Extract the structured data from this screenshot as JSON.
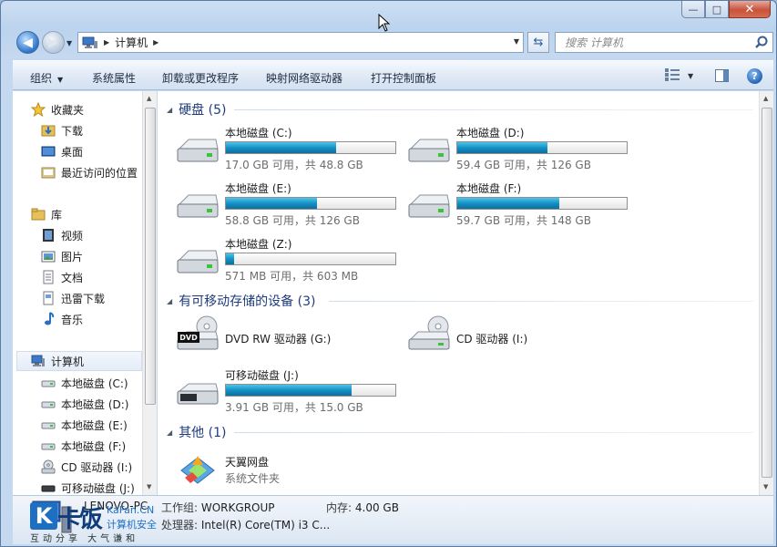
{
  "window": {
    "caption_buttons": {
      "minimize": "—",
      "maximize": "□",
      "close": "✕"
    }
  },
  "nav": {
    "breadcrumb": [
      "计算机"
    ],
    "search_placeholder": "搜索 计算机"
  },
  "command_bar": {
    "items": [
      "组织",
      "系统属性",
      "卸载或更改程序",
      "映射网络驱动器",
      "打开控制面板"
    ]
  },
  "sidebar": {
    "favorites": {
      "label": "收藏夹",
      "items": [
        "下载",
        "桌面",
        "最近访问的位置"
      ]
    },
    "libraries": {
      "label": "库",
      "items": [
        "视频",
        "图片",
        "文档",
        "迅雷下载",
        "音乐"
      ]
    },
    "computer": {
      "label": "计算机",
      "items": [
        "本地磁盘 (C:)",
        "本地磁盘 (D:)",
        "本地磁盘 (E:)",
        "本地磁盘 (F:)",
        "CD 驱动器 (I:)",
        "可移动磁盘 (J:)"
      ]
    }
  },
  "groups": {
    "hard_disks": {
      "title": "硬盘 (5)",
      "drives": [
        {
          "name": "本地磁盘 (C:)",
          "info": "17.0 GB 可用，共 48.8 GB",
          "used_fraction": 0.65
        },
        {
          "name": "本地磁盘 (D:)",
          "info": "59.4 GB 可用，共 126 GB",
          "used_fraction": 0.53
        },
        {
          "name": "本地磁盘 (E:)",
          "info": "58.8 GB 可用，共 126 GB",
          "used_fraction": 0.54
        },
        {
          "name": "本地磁盘 (F:)",
          "info": "59.7 GB 可用，共 148 GB",
          "used_fraction": 0.6
        },
        {
          "name": "本地磁盘 (Z:)",
          "info": "571 MB 可用，共 603 MB",
          "used_fraction": 0.05
        }
      ]
    },
    "removable": {
      "title": "有可移动存储的设备 (3)",
      "devices": [
        {
          "name": "DVD RW 驱动器 (G:)",
          "icon_label": "DVD"
        },
        {
          "name": "CD 驱动器 (I:)"
        },
        {
          "name": "可移动磁盘 (J:)",
          "info": "3.91 GB 可用，共 15.0 GB",
          "used_fraction": 0.74
        }
      ]
    },
    "other": {
      "title": "其他 (1)",
      "items": [
        {
          "name": "天翼网盘",
          "type": "系统文件夹"
        }
      ]
    }
  },
  "details": {
    "name": "LENOVO-PC",
    "workgroup_label": "工作组:",
    "workgroup": "WORKGROUP",
    "memory_label": "内存:",
    "memory": "4.00 GB",
    "cpu_label": "处理器:",
    "cpu": "Intel(R) Core(TM) i3 C..."
  },
  "watermark": {
    "logo_letter": "K",
    "main": "卡饭",
    "site": "KaFan.CN",
    "security": "计算机安全",
    "slogan": "互动分享  大气谦和"
  },
  "colors": {
    "accent": "#1591c5",
    "group_heading": "#1e3b7d",
    "close_button": "#c7533c"
  }
}
